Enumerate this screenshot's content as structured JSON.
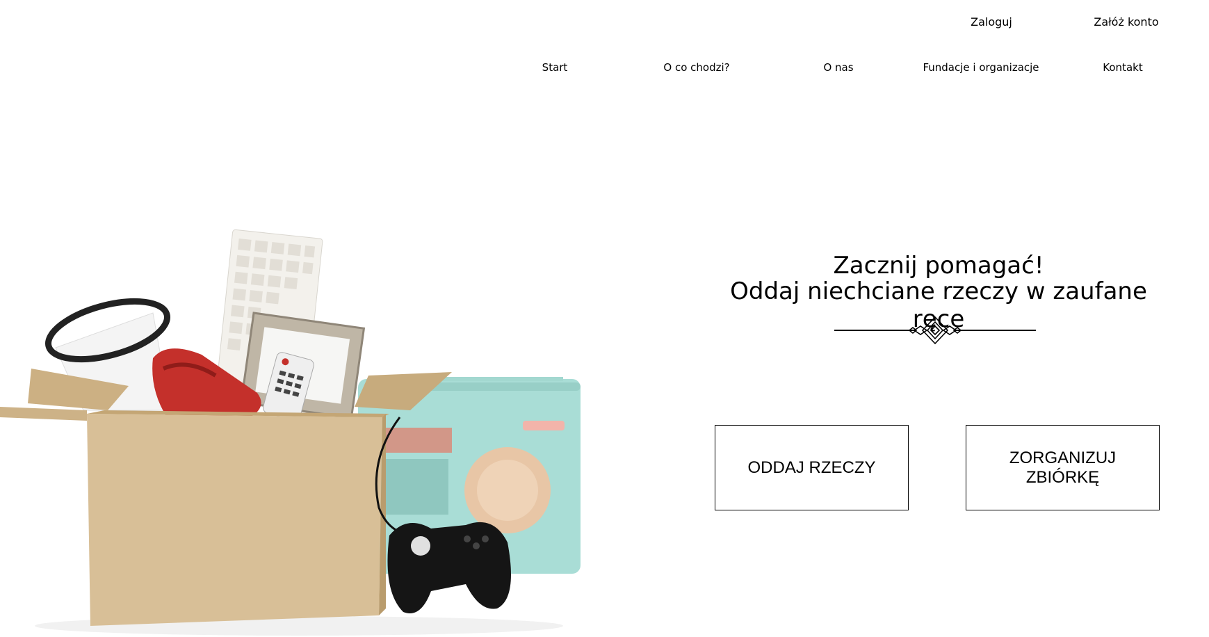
{
  "header": {
    "login": "Zaloguj",
    "register": "Załóż konto"
  },
  "nav": {
    "start": "Start",
    "about_what": "O co chodzi?",
    "about_us": "O nas",
    "foundations": "Fundacje i organizacje",
    "contact": "Kontakt"
  },
  "hero": {
    "title_line1": "Zacznij pomagać!",
    "title_line2": "Oddaj niechciane rzeczy w zaufane ręce",
    "button_give": "ODDAJ RZECZY",
    "button_organize": "ZORGANIZUJ ZBIÓRKĘ",
    "image_icon": "donation-box-illustration",
    "decoration_icon": "ornament-divider-icon"
  },
  "colors": {
    "text": "#000000",
    "background": "#ffffff",
    "box": "#d8bf97",
    "radio": "#a9ddd6",
    "phone": "#c4302b"
  }
}
